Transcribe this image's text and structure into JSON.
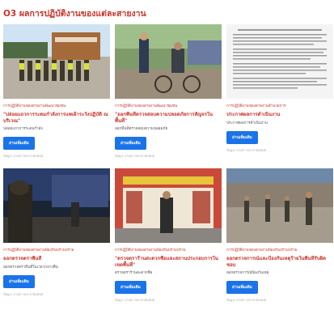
{
  "page": {
    "heading": "O3 ผลการปฏิบัติงานของแต่ละสายงาน"
  },
  "cards": [
    {
      "category": "การปฏิบัติงานของสายงานพัฒนาชุมชน",
      "title": "\"ปล่อยแถวการระดมกำลังการแพเฝ้าระวังปฏิบัติ ณ บริเวณ\"",
      "excerpt": "ปล่อยแถวการระดมกำลัง",
      "button": "อ่านเพิ่มเติม",
      "meta": "ข้อมูล: งานข่าวประชาสัมพันธ์"
    },
    {
      "category": "การปฏิบัติงานของสายงานพัฒนาชุมชน",
      "title": "\"ออกพื้นที่ตรวจสอบความปลอดภัยการสัญจรในพื้นที่\"",
      "excerpt": "ออกพื้นที่ตรวจสอบความปลอดภัย",
      "button": "อ่านเพิ่มเติม",
      "meta": "ข้อมูล: งานข่าวประชาสัมพันธ์"
    },
    {
      "category": "การปฏิบัติงานของสายงานอำนวยการ",
      "title": "ประกาศผลการดำเนินงาน",
      "excerpt": "ประกาศผลการดำเนินงาน",
      "button": "อ่านเพิ่มเติม",
      "meta": "ข้อมูล: งานข่าวประชาสัมพันธ์"
    },
    {
      "category": "การปฏิบัติงานของสายงานป้องกันปราบปราม",
      "title": "ออกตรวจตราพื้นที่",
      "excerpt": "ออกตรวจตราพื้นที่ในเวลากลางคืน",
      "button": "อ่านเพิ่มเติม",
      "meta": "ข้อมูล: งานข่าวประชาสัมพันธ์"
    },
    {
      "category": "การปฏิบัติงานของสายงานป้องกันปราบปราม",
      "title": "\"ตรวจตราร้านสะดวกซื้อและสถานประกอบการในเขตพื้นที่\"",
      "excerpt": "ตรวจตราร้านสะดวกซื้อ",
      "button": "อ่านเพิ่มเติม",
      "meta": "ข้อมูล: งานข่าวประชาสัมพันธ์"
    },
    {
      "category": "การปฏิบัติงานของสายงานป้องกันปราบปราม",
      "title": "ออกตรวจการณ์และป้องกันเหตุร้ายในพื้นที่รับผิดชอบ",
      "excerpt": "ออกตรวจการณ์ป้องกันเหตุ",
      "button": "อ่านเพิ่มเติม",
      "meta": "ข้อมูล: งานข่าวประชาสัมพันธ์"
    }
  ]
}
